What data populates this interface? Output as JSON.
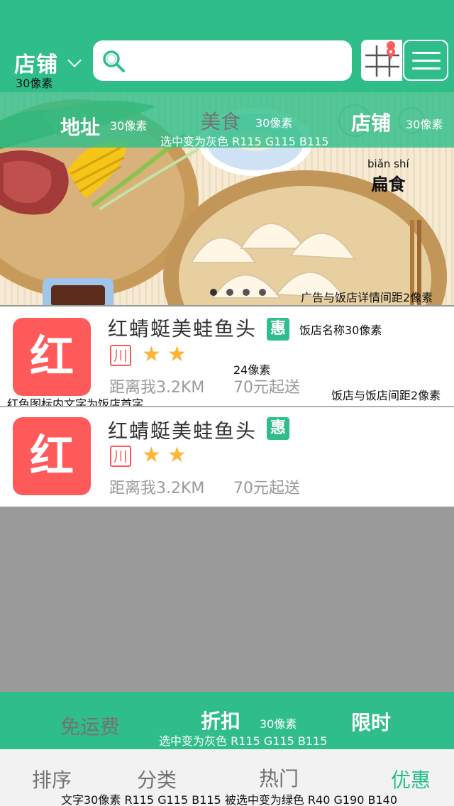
{
  "header": {
    "store_label": "店铺",
    "store_note": "30像素",
    "search_placeholder": ""
  },
  "banner": {
    "tabs": [
      {
        "label": "地址",
        "note": "30像素",
        "selected": true
      },
      {
        "label": "美食",
        "note": "30像素",
        "selected": false
      },
      {
        "label": "店铺",
        "note": "30像素",
        "selected": true
      }
    ],
    "tabs_note": "选中变为灰色 R115 G115 B115",
    "image_text": {
      "pinyin": "biǎn shí",
      "hanzi": "扁食"
    },
    "carousel_dots": 4,
    "carousel_active": 0,
    "spacing_note": "广告与饭店详情间距2像素"
  },
  "restaurants": [
    {
      "icon_char": "红",
      "name": "红蜻蜓美蛙鱼头",
      "badge": "惠",
      "cuisine": "川",
      "stars": 2,
      "distance": "距离我3.2KM",
      "min_order": "70元起送"
    },
    {
      "icon_char": "红",
      "name": "红蜻蜓美蛙鱼头",
      "badge": "惠",
      "cuisine": "川",
      "stars": 2,
      "distance": "距离我3.2KM",
      "min_order": "70元起送"
    }
  ],
  "annotations": {
    "name_size": "饭店名称30像素",
    "text_size": "24像素",
    "icon_note": "红色图标内文字为饭店首字",
    "gap_note": "饭店与饭店间距2像素"
  },
  "filter_bar": {
    "tabs": [
      {
        "label": "免运费",
        "selected": true
      },
      {
        "label": "折扣",
        "selected": false
      },
      {
        "label": "限时",
        "selected": false
      }
    ],
    "size_note": "30像素",
    "note": "选中变为灰色 R115 G115 B115"
  },
  "bottom_nav": {
    "tabs": [
      {
        "label": "排序",
        "active": false
      },
      {
        "label": "分类",
        "active": false
      },
      {
        "label": "热门",
        "active": false
      },
      {
        "label": "优惠",
        "active": true
      }
    ],
    "note": "文字30像素 R115 G115 B115 被选中变为绿色 R40 G190 B140"
  },
  "colors": {
    "green": "#2fbe8a",
    "grey_text": "#737373",
    "active_green": "#28be8c",
    "red_icon": "#ff5a5a"
  }
}
